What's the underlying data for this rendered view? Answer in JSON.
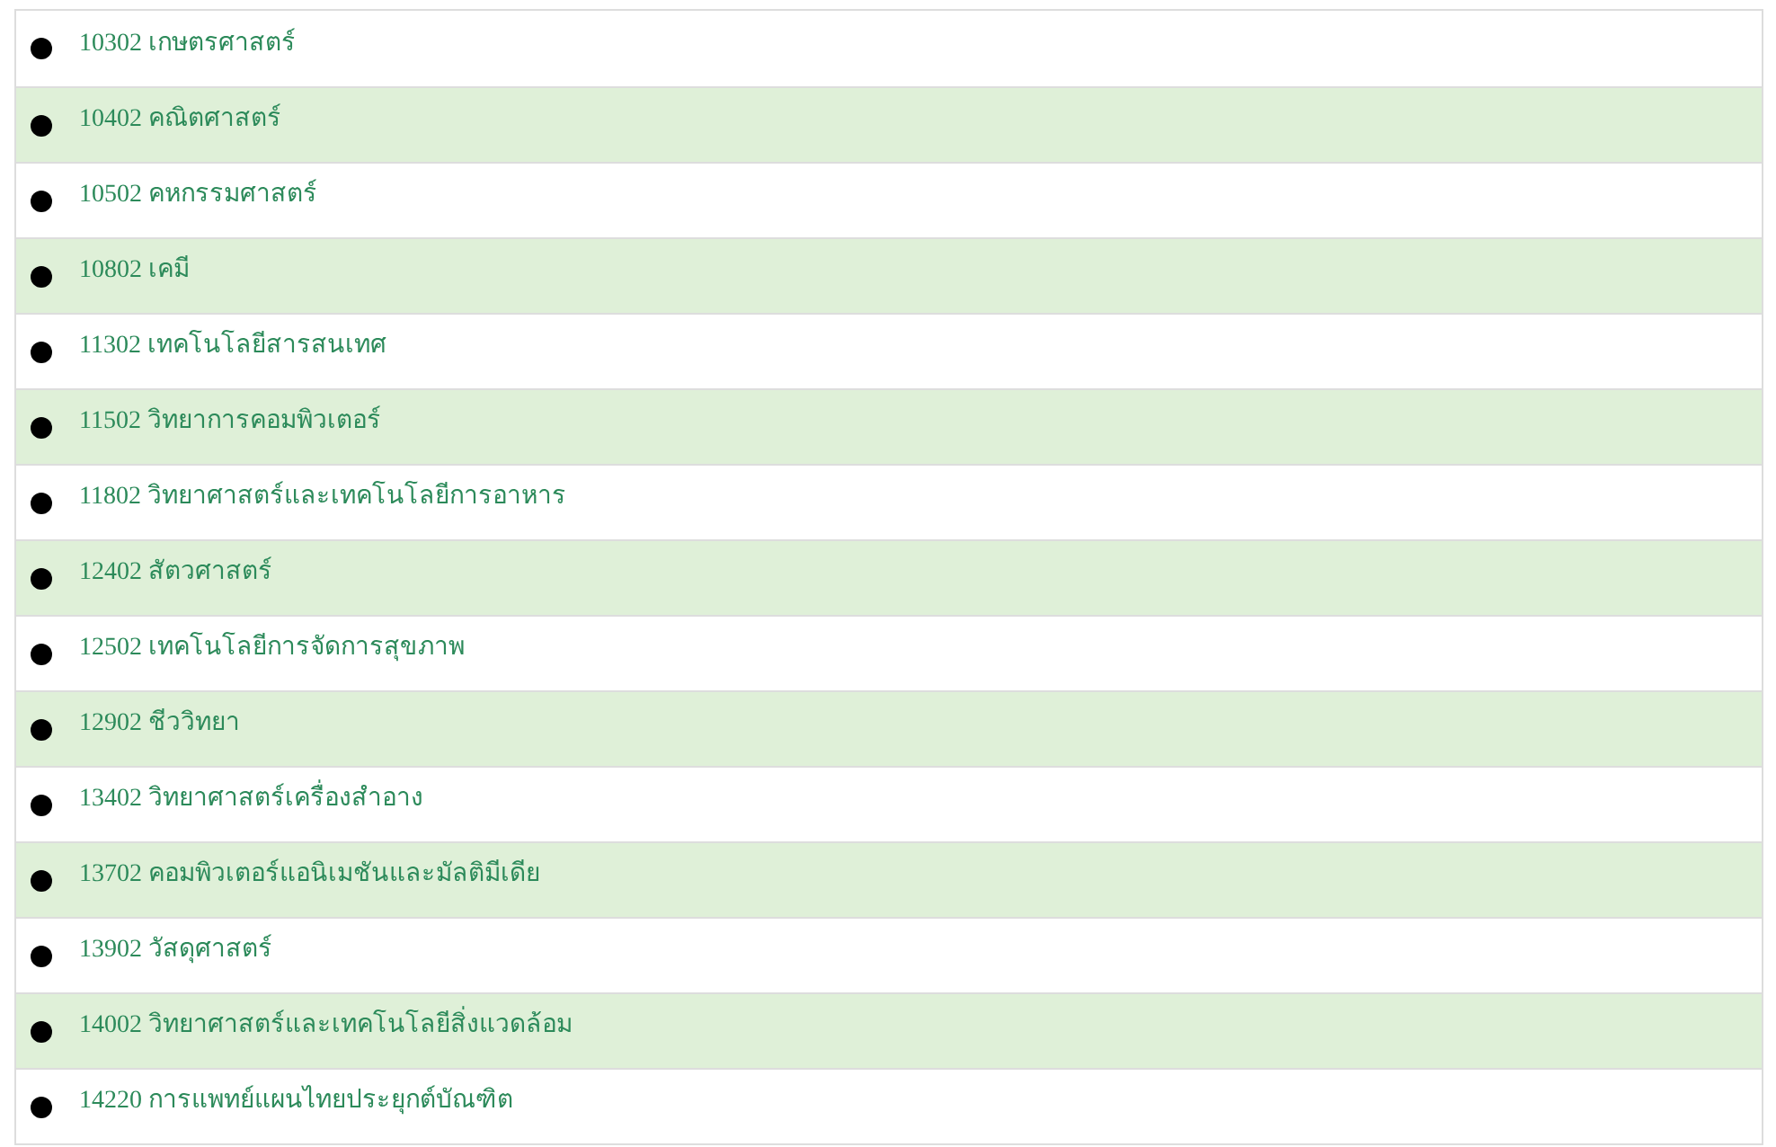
{
  "programs": [
    {
      "label": "10302 เกษตรศาสตร์"
    },
    {
      "label": "10402 คณิตศาสตร์"
    },
    {
      "label": "10502 คหกรรมศาสตร์"
    },
    {
      "label": "10802 เคมี"
    },
    {
      "label": "11302 เทคโนโลยีสารสนเทศ"
    },
    {
      "label": "11502 วิทยาการคอมพิวเตอร์"
    },
    {
      "label": "11802 วิทยาศาสตร์และเทคโนโลยีการอาหาร"
    },
    {
      "label": "12402 สัตวศาสตร์"
    },
    {
      "label": "12502 เทคโนโลยีการจัดการสุขภาพ"
    },
    {
      "label": "12902 ชีววิทยา"
    },
    {
      "label": "13402 วิทยาศาสตร์เครื่องสำอาง"
    },
    {
      "label": "13702 คอมพิวเตอร์แอนิเมชันและมัลติมีเดีย"
    },
    {
      "label": "13902 วัสดุศาสตร์"
    },
    {
      "label": "14002 วิทยาศาสตร์และเทคโนโลยีสิ่งแวดล้อม"
    },
    {
      "label": "14220 การแพทย์แผนไทยประยุกต์บัณฑิต"
    }
  ]
}
